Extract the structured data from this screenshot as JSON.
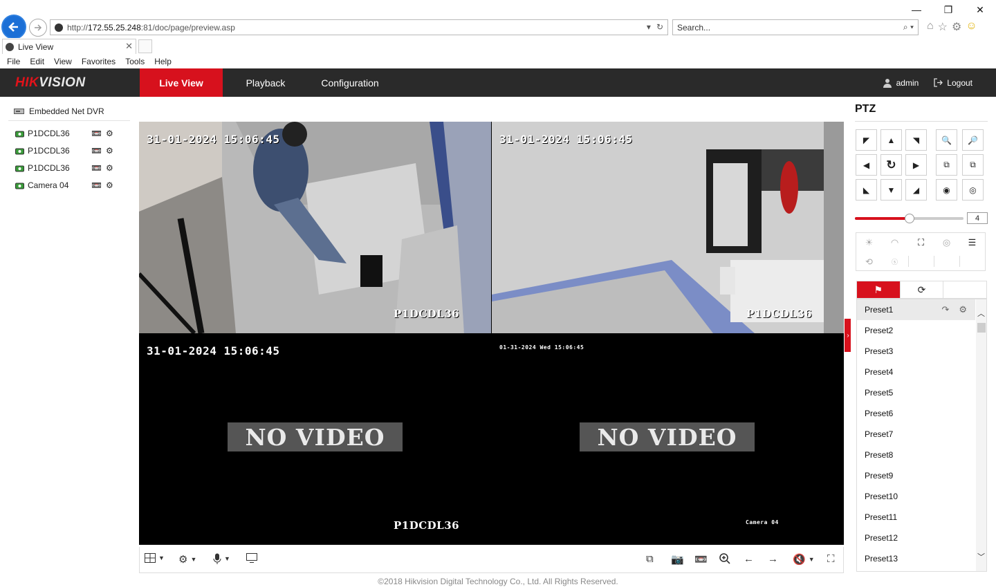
{
  "browser": {
    "url_prefix": "http://",
    "url_host": "172.55.25.248",
    "url_rest": ":81/doc/page/preview.asp",
    "search_placeholder": "Search...",
    "tab_title": "Live View",
    "menu": [
      "File",
      "Edit",
      "View",
      "Favorites",
      "Tools",
      "Help"
    ]
  },
  "app": {
    "logo_red": "HIK",
    "logo_white": "VISION",
    "nav": [
      "Live View",
      "Playback",
      "Configuration"
    ],
    "active_nav": "Live View",
    "user": "admin",
    "logout": "Logout",
    "accent_color": "#d7111d"
  },
  "device_tree": {
    "dvr": "Embedded Net DVR",
    "cameras": [
      "P1DCDL36",
      "P1DCDL36",
      "P1DCDL36",
      "Camera 04"
    ]
  },
  "video": {
    "tiles": [
      {
        "timestamp": "31-01-2024 15:06:45",
        "label": "P1DCDL36",
        "signal": true
      },
      {
        "timestamp": "31-01-2024 15:06:45",
        "label": "P1DCDL36",
        "signal": true
      },
      {
        "timestamp": "31-01-2024 15:06:45",
        "label": "P1DCDL36",
        "signal": false,
        "message": "NO VIDEO"
      },
      {
        "timestamp": "01-31-2024 Wed 15:06:45",
        "label": "Camera 04",
        "signal": false,
        "message": "NO VIDEO"
      }
    ]
  },
  "ptz": {
    "title": "PTZ",
    "speed": "4",
    "speed_fraction": 0.5,
    "presets": [
      "Preset1",
      "Preset2",
      "Preset3",
      "Preset4",
      "Preset5",
      "Preset6",
      "Preset7",
      "Preset8",
      "Preset9",
      "Preset10",
      "Preset11",
      "Preset12",
      "Preset13"
    ]
  },
  "footer": "©2018 Hikvision Digital Technology Co., Ltd. All Rights Reserved."
}
